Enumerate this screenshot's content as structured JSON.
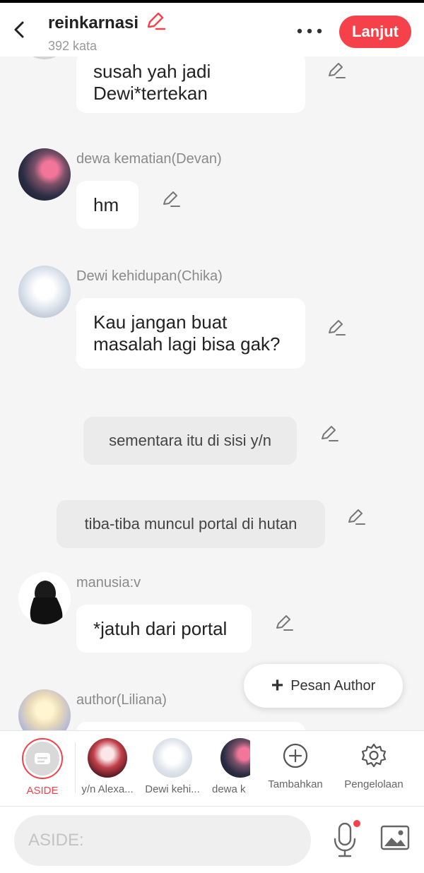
{
  "header": {
    "title": "reinkarnasi",
    "word_count": "392 kata",
    "next_label": "Lanjut",
    "accent": "#f5424a"
  },
  "messages": [
    {
      "type": "character",
      "text_line1": "susah yah jadi",
      "text_line2": "Dewi*tertekan"
    },
    {
      "type": "character",
      "name": "dewa kematian(Devan)",
      "text": "hm"
    },
    {
      "type": "character",
      "name": "Dewi kehidupan(Chika)",
      "text_line1": "Kau jangan buat",
      "text_line2": "masalah lagi bisa gak?"
    },
    {
      "type": "narration",
      "text": "sementara itu di sisi y/n"
    },
    {
      "type": "narration",
      "text": "tiba-tiba muncul portal di hutan"
    },
    {
      "type": "character",
      "name": "manusia:v",
      "text": "*jatuh dari portal"
    },
    {
      "type": "character",
      "name": "author(Liliana)"
    }
  ],
  "floating_button": {
    "label": "Pesan Author"
  },
  "character_bar": {
    "aside": "ASIDE",
    "characters": [
      "y/n Alexa...",
      "Dewi kehi...",
      "dewa k"
    ],
    "add": "Tambahkan",
    "manage": "Pengelolaan"
  },
  "composer": {
    "placeholder": "ASIDE:"
  }
}
